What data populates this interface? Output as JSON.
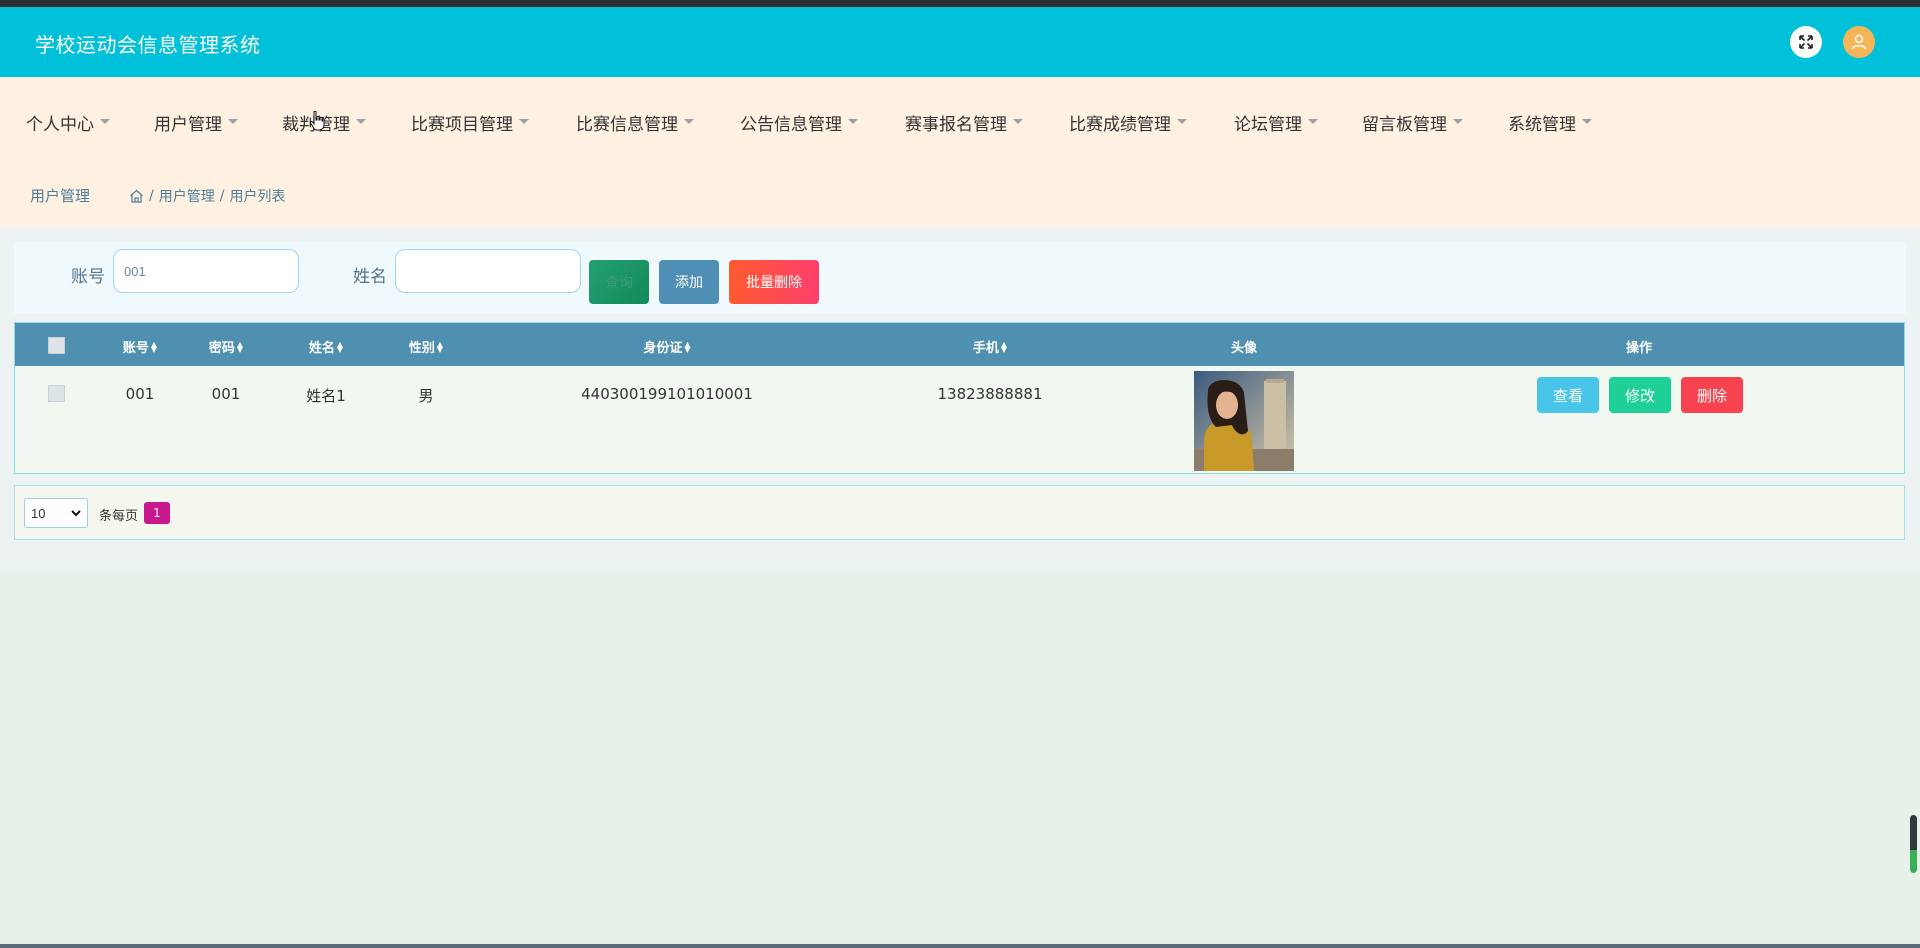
{
  "header": {
    "title": "学校运动会信息管理系统"
  },
  "nav": {
    "items": [
      "个人中心",
      "用户管理",
      "裁判管理",
      "比赛项目管理",
      "比赛信息管理",
      "公告信息管理",
      "赛事报名管理",
      "比赛成绩管理",
      "论坛管理",
      "留言板管理",
      "系统管理"
    ]
  },
  "breadcrumb": {
    "title": "用户管理",
    "path": [
      "用户管理",
      "用户列表"
    ],
    "separator": "/"
  },
  "search": {
    "account_label": "账号",
    "account_value": "001",
    "name_label": "姓名",
    "name_value": "",
    "search_button": "查询",
    "add_button": "添加",
    "bulk_delete_button": "批量删除"
  },
  "table": {
    "columns": [
      "账号",
      "密码",
      "姓名",
      "性别",
      "身份证",
      "手机",
      "头像",
      "操作"
    ],
    "rows": [
      {
        "account": "001",
        "password": "001",
        "name": "姓名1",
        "gender": "男",
        "id_card": "440300199101010001",
        "phone": "13823888881"
      }
    ],
    "actions": {
      "view": "查看",
      "edit": "修改",
      "delete": "删除"
    }
  },
  "pagination": {
    "page_size": "10",
    "per_page_label": "条每页",
    "current_page": "1"
  },
  "colors": {
    "header_bg": "#00c1d9",
    "nav_bg": "#fff1e2",
    "table_header_bg": "#4f8fb0",
    "view_btn": "#4ac5ea",
    "edit_btn": "#1fcf98",
    "delete_btn": "#f8424f",
    "page_active": "#c9188e"
  }
}
